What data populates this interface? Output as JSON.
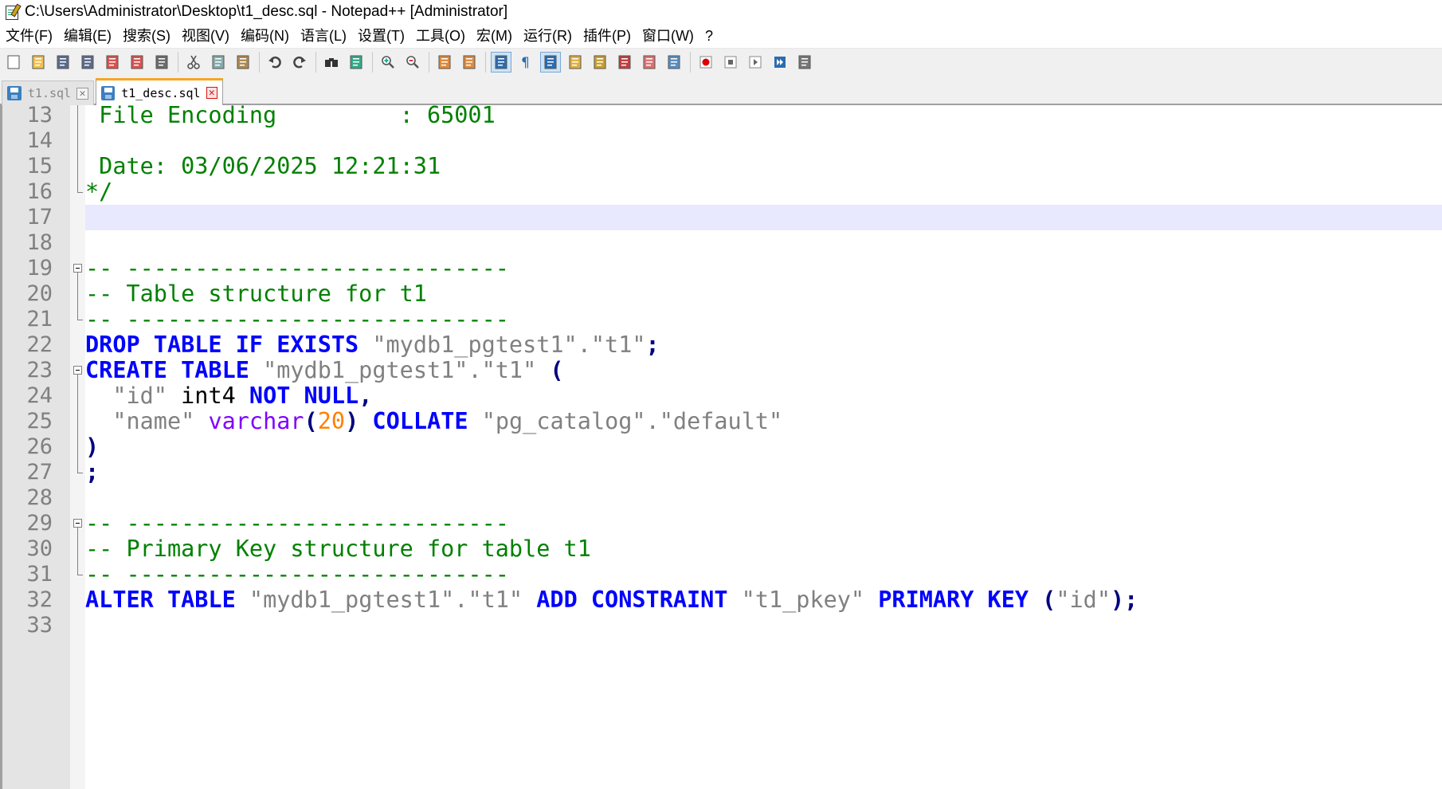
{
  "window": {
    "title": "C:\\Users\\Administrator\\Desktop\\t1_desc.sql - Notepad++ [Administrator]"
  },
  "menu": [
    "文件(F)",
    "编辑(E)",
    "搜索(S)",
    "视图(V)",
    "编码(N)",
    "语言(L)",
    "设置(T)",
    "工具(O)",
    "宏(M)",
    "运行(R)",
    "插件(P)",
    "窗口(W)",
    "?"
  ],
  "toolbar": {
    "icons": [
      "new-file-icon",
      "open-file-icon",
      "save-icon",
      "save-all-icon",
      "close-icon",
      "close-all-icon",
      "print-icon",
      "cut-icon",
      "copy-icon",
      "paste-icon",
      "undo-icon",
      "redo-icon",
      "find-icon",
      "replace-icon",
      "zoom-in-icon",
      "zoom-out-icon",
      "sync-vertical-icon",
      "sync-horizontal-icon",
      "word-wrap-icon",
      "show-all-chars-icon",
      "indent-guide-icon",
      "udl-icon",
      "doc-map-icon",
      "function-list-icon",
      "folder-workspace-icon",
      "monitor-icon",
      "record-macro-icon",
      "stop-record-icon",
      "play-macro-icon",
      "run-macro-multiple-icon",
      "save-macro-icon"
    ],
    "active": [
      "word-wrap-icon",
      "indent-guide-icon"
    ]
  },
  "tabs": [
    {
      "label": "t1.sql",
      "active": false
    },
    {
      "label": "t1_desc.sql",
      "active": true
    }
  ],
  "editor": {
    "current_line": 17,
    "lines": [
      {
        "n": "13",
        "tokens": [
          {
            "t": " File Encoding         : 65001",
            "c": "cm"
          }
        ]
      },
      {
        "n": "14",
        "tokens": []
      },
      {
        "n": "15",
        "tokens": [
          {
            "t": " Date: 03/06/2025 12:21:31",
            "c": "cm"
          }
        ]
      },
      {
        "n": "16",
        "tokens": [
          {
            "t": "*/",
            "c": "cm"
          }
        ]
      },
      {
        "n": "17",
        "tokens": []
      },
      {
        "n": "18",
        "tokens": []
      },
      {
        "n": "19",
        "tokens": [
          {
            "t": "-- ----------------------------",
            "c": "cm"
          }
        ]
      },
      {
        "n": "20",
        "tokens": [
          {
            "t": "-- Table structure for t1",
            "c": "cm"
          }
        ]
      },
      {
        "n": "21",
        "tokens": [
          {
            "t": "-- ----------------------------",
            "c": "cm"
          }
        ]
      },
      {
        "n": "22",
        "tokens": [
          {
            "t": "DROP TABLE IF EXISTS",
            "c": "kw"
          },
          {
            "t": " ",
            "c": "plain"
          },
          {
            "t": "\"mydb1_pgtest1\".\"t1\"",
            "c": "str"
          },
          {
            "t": ";",
            "c": "op"
          }
        ]
      },
      {
        "n": "23",
        "tokens": [
          {
            "t": "CREATE TABLE",
            "c": "kw"
          },
          {
            "t": " ",
            "c": "plain"
          },
          {
            "t": "\"mydb1_pgtest1\".\"t1\"",
            "c": "str"
          },
          {
            "t": " (",
            "c": "op"
          }
        ]
      },
      {
        "n": "24",
        "tokens": [
          {
            "t": "  ",
            "c": "plain"
          },
          {
            "t": "\"id\"",
            "c": "str"
          },
          {
            "t": " int4 ",
            "c": "plain"
          },
          {
            "t": "NOT NULL",
            "c": "kw"
          },
          {
            "t": ",",
            "c": "op"
          }
        ]
      },
      {
        "n": "25",
        "tokens": [
          {
            "t": "  ",
            "c": "plain"
          },
          {
            "t": "\"name\"",
            "c": "str"
          },
          {
            "t": " ",
            "c": "plain"
          },
          {
            "t": "varchar",
            "c": "ty"
          },
          {
            "t": "(",
            "c": "op"
          },
          {
            "t": "20",
            "c": "num"
          },
          {
            "t": ")",
            "c": "op"
          },
          {
            "t": " ",
            "c": "plain"
          },
          {
            "t": "COLLATE",
            "c": "kw"
          },
          {
            "t": " ",
            "c": "plain"
          },
          {
            "t": "\"pg_catalog\".\"default\"",
            "c": "str"
          }
        ]
      },
      {
        "n": "26",
        "tokens": [
          {
            "t": ")",
            "c": "op"
          }
        ]
      },
      {
        "n": "27",
        "tokens": [
          {
            "t": ";",
            "c": "op"
          }
        ]
      },
      {
        "n": "28",
        "tokens": []
      },
      {
        "n": "29",
        "tokens": [
          {
            "t": "-- ----------------------------",
            "c": "cm"
          }
        ]
      },
      {
        "n": "30",
        "tokens": [
          {
            "t": "-- Primary Key structure for table t1",
            "c": "cm"
          }
        ]
      },
      {
        "n": "31",
        "tokens": [
          {
            "t": "-- ----------------------------",
            "c": "cm"
          }
        ]
      },
      {
        "n": "32",
        "tokens": [
          {
            "t": "ALTER TABLE",
            "c": "kw"
          },
          {
            "t": " ",
            "c": "plain"
          },
          {
            "t": "\"mydb1_pgtest1\".\"t1\"",
            "c": "str"
          },
          {
            "t": " ",
            "c": "plain"
          },
          {
            "t": "ADD CONSTRAINT",
            "c": "kw"
          },
          {
            "t": " ",
            "c": "plain"
          },
          {
            "t": "\"t1_pkey\"",
            "c": "str"
          },
          {
            "t": " ",
            "c": "plain"
          },
          {
            "t": "PRIMARY KEY",
            "c": "kw"
          },
          {
            "t": " (",
            "c": "op"
          },
          {
            "t": "\"id\"",
            "c": "str"
          },
          {
            "t": ");",
            "c": "op"
          }
        ]
      },
      {
        "n": "33",
        "tokens": []
      }
    ]
  }
}
